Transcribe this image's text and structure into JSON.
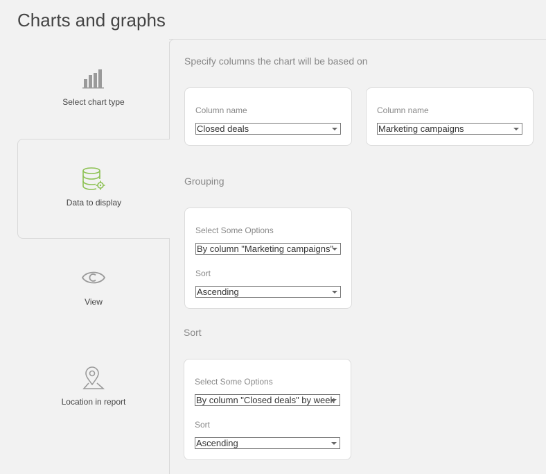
{
  "page": {
    "title": "Charts and graphs"
  },
  "steps": [
    {
      "label": "Select chart type",
      "icon": "bar-chart-icon"
    },
    {
      "label": "Data to display",
      "icon": "database-gear-icon",
      "active": true
    },
    {
      "label": "View",
      "icon": "eye-icon"
    },
    {
      "label": "Location in report",
      "icon": "location-pin-icon"
    }
  ],
  "columns_section": {
    "heading": "Specify columns the chart will be based on",
    "column1": {
      "label": "Column name",
      "value": "Closed deals"
    },
    "column2": {
      "label": "Column name",
      "value": "Marketing campaigns"
    }
  },
  "grouping_section": {
    "heading": "Grouping",
    "options_label": "Select Some Options",
    "options_value": "By column \"Marketing campaigns\"",
    "sort_label": "Sort",
    "sort_value": "Ascending"
  },
  "sort_section": {
    "heading": "Sort",
    "options_label": "Select Some Options",
    "options_value": "By column \"Closed deals\" by week",
    "sort_label": "Sort",
    "sort_value": "Ascending"
  },
  "colors": {
    "accent": "#8cc152",
    "icon_gray": "#9a9a9a",
    "border": "#d9d9d9"
  }
}
